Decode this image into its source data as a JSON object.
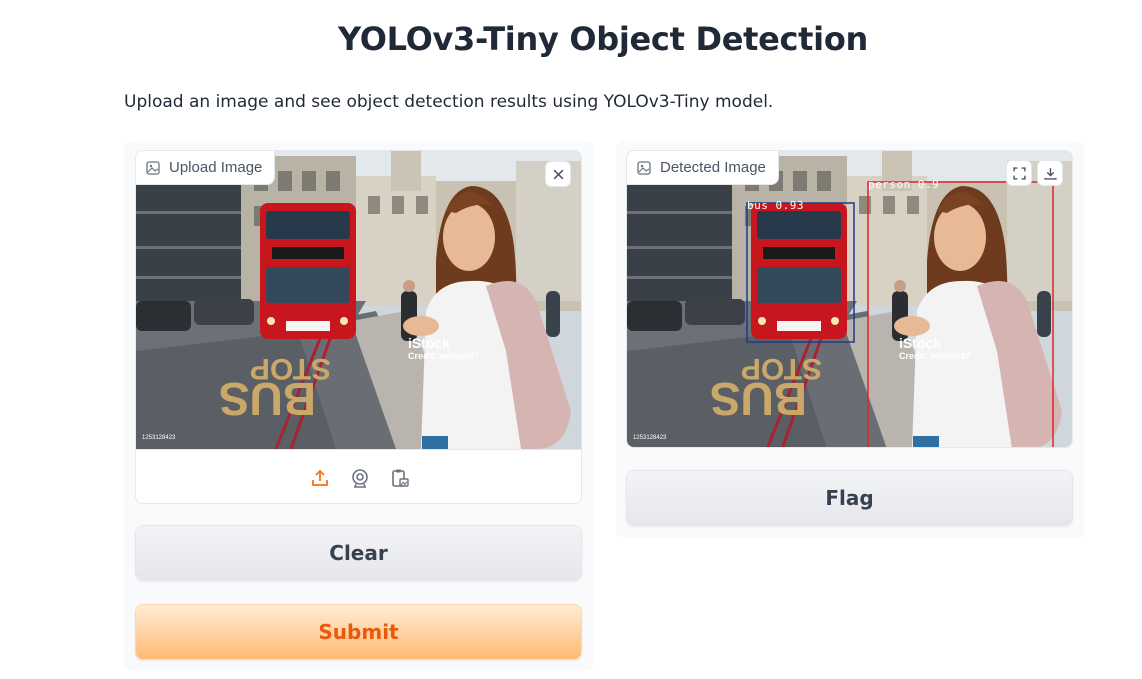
{
  "page": {
    "title": "YOLOv3-Tiny Object Detection",
    "description": "Upload an image and see object detection results using YOLOv3-Tiny model."
  },
  "input_panel": {
    "label": "Upload Image",
    "label_icon": "image-icon",
    "close_icon": "close-icon",
    "watermark": {
      "brand": "iStock",
      "credit": "Credit: william87",
      "id": "1253128423"
    },
    "sources": [
      {
        "name": "upload-icon",
        "color": "#f97316"
      },
      {
        "name": "webcam-icon",
        "color": "#6b7280"
      },
      {
        "name": "clipboard-icon",
        "color": "#6b7280"
      }
    ]
  },
  "output_panel": {
    "label": "Detected Image",
    "label_icon": "image-icon",
    "actions": [
      "fullscreen-icon",
      "download-icon"
    ],
    "watermark": {
      "brand": "iStock",
      "credit": "Credit: william87",
      "id": "1253128423"
    },
    "detections": [
      {
        "label": "bus 0.93",
        "color": "#1e3a8a"
      },
      {
        "label": "person 0.9",
        "color": "#dc2626"
      }
    ]
  },
  "buttons": {
    "clear": "Clear",
    "submit": "Submit",
    "flag": "Flag"
  },
  "colors": {
    "accent": "#f97316",
    "primary_text": "#ea580c",
    "panel_bg": "#f9fafb"
  }
}
